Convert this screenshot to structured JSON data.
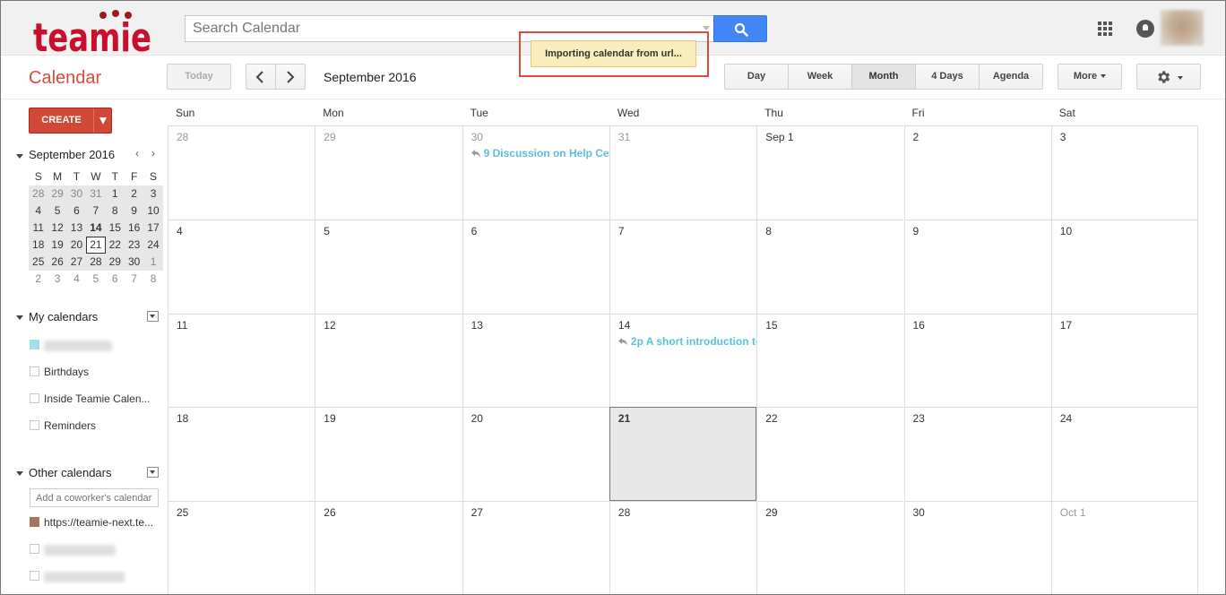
{
  "header": {
    "logo_text": "teamie",
    "search": {
      "placeholder": "Search Calendar"
    },
    "icons": [
      "search-icon",
      "apps-grid-icon",
      "notifications-bell-icon",
      "user-avatar"
    ]
  },
  "toolbar": {
    "title": "Calendar",
    "today_label": "Today",
    "current_month": "September 2016",
    "views": [
      "Day",
      "Week",
      "Month",
      "4 Days",
      "Agenda"
    ],
    "active_view": "Month",
    "more_label": "More"
  },
  "notification": {
    "text": "Importing calendar from url..."
  },
  "sidebar": {
    "create_label": "CREATE",
    "mini_calendar": {
      "title": "September 2016",
      "weekday_headers": [
        "S",
        "M",
        "T",
        "W",
        "T",
        "F",
        "S"
      ],
      "weeks": [
        [
          "28",
          "29",
          "30",
          "31",
          "1",
          "2",
          "3"
        ],
        [
          "4",
          "5",
          "6",
          "7",
          "8",
          "9",
          "10"
        ],
        [
          "11",
          "12",
          "13",
          "14",
          "15",
          "16",
          "17"
        ],
        [
          "18",
          "19",
          "20",
          "21",
          "22",
          "23",
          "24"
        ],
        [
          "25",
          "26",
          "27",
          "28",
          "29",
          "30",
          "1"
        ],
        [
          "2",
          "3",
          "4",
          "5",
          "6",
          "7",
          "8"
        ]
      ]
    },
    "my_calendars": {
      "title": "My calendars",
      "items": [
        "",
        "Birthdays",
        "Inside Teamie Calen...",
        "Reminders"
      ]
    },
    "other_calendars": {
      "title": "Other calendars",
      "add_placeholder": "Add a coworker's calendar",
      "items": [
        "https://teamie-next.te...",
        "",
        ""
      ]
    }
  },
  "month_grid": {
    "weekdays": [
      "Sun",
      "Mon",
      "Tue",
      "Wed",
      "Thu",
      "Fri",
      "Sat"
    ],
    "weeks": [
      [
        "28",
        "29",
        "30",
        "31",
        "Sep 1",
        "2",
        "3"
      ],
      [
        "4",
        "5",
        "6",
        "7",
        "8",
        "9",
        "10"
      ],
      [
        "11",
        "12",
        "13",
        "14",
        "15",
        "16",
        "17"
      ],
      [
        "18",
        "19",
        "20",
        "21",
        "22",
        "23",
        "24"
      ],
      [
        "25",
        "26",
        "27",
        "28",
        "29",
        "30",
        "Oct 1"
      ]
    ],
    "events": {
      "tue_30": {
        "time": "9",
        "title": "Discussion on Help Cer"
      },
      "wed_14": {
        "time": "2p",
        "title": "A short introduction to"
      }
    }
  },
  "colors": {
    "accent_red": "#dd4b39",
    "create_button": "#d14836",
    "search_button": "#4285f4",
    "event_text": "#5bc0de",
    "notification_bg": "#f9edbe",
    "my_calendar_swatch": "#9fe1e7",
    "other_calendar_swatch": "#ac725e"
  }
}
